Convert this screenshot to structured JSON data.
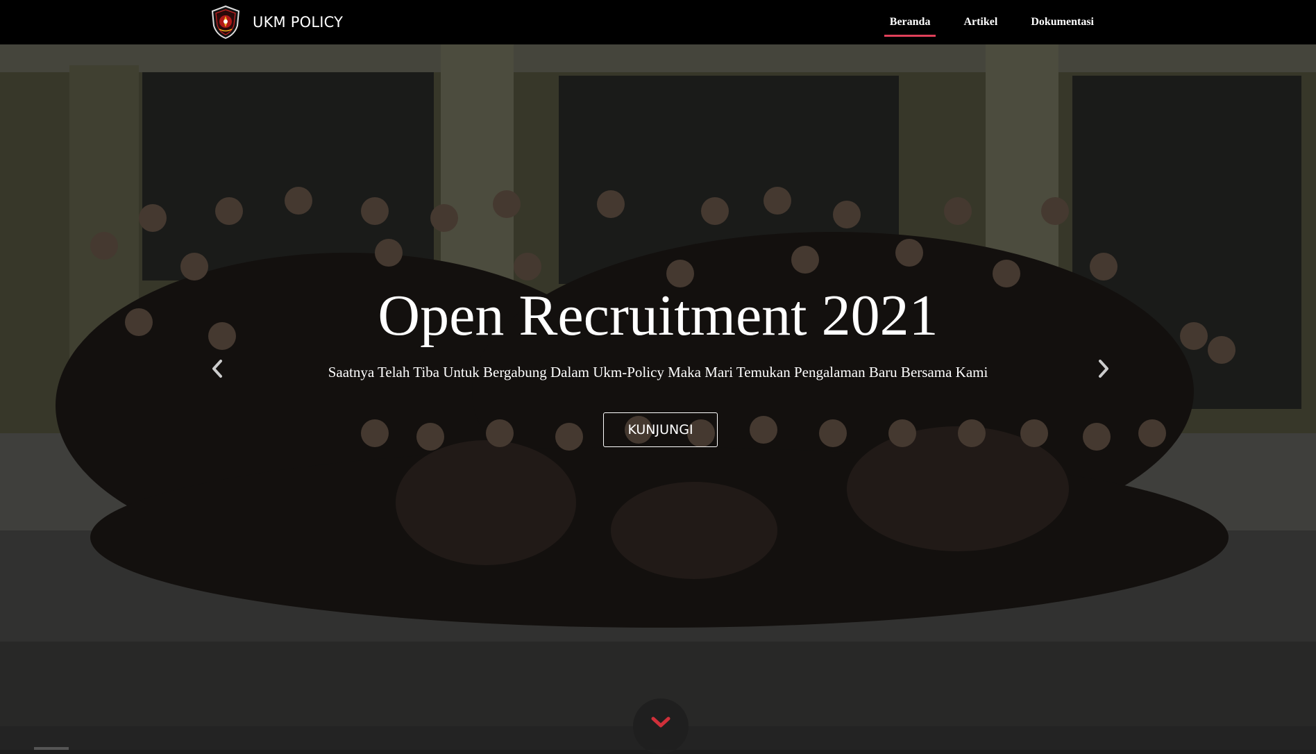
{
  "brand": {
    "name": "UKM POLICY",
    "logo_icon": "shield-emblem-icon"
  },
  "nav": {
    "items": [
      {
        "label": "Beranda",
        "active": true
      },
      {
        "label": "Artikel",
        "active": false
      },
      {
        "label": "Dokumentasi",
        "active": false
      }
    ],
    "active_color": "#e0405a"
  },
  "hero": {
    "title": "Open Recruitment 2021",
    "subtitle": "Saatnya Telah Tiba Untuk Bergabung Dalam Ukm-Policy Maka Mari Temukan Pengalaman Baru Bersama Kami",
    "button_label": "KUNJUNGI",
    "prev_icon": "chevron-left-icon",
    "next_icon": "chevron-right-icon"
  },
  "scroll_down": {
    "icon": "chevron-down-icon",
    "color": "#d0303a"
  }
}
